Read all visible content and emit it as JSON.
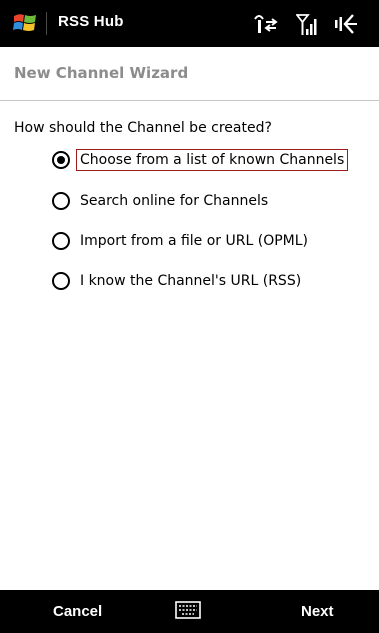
{
  "title_bar": {
    "app_title": "RSS Hub",
    "icons": [
      "windows-start-icon",
      "data-connection-icon",
      "signal-strength-icon",
      "volume-icon"
    ]
  },
  "subheader": {
    "title": "New Channel Wizard"
  },
  "wizard": {
    "question": "How should the Channel be created?",
    "options": [
      {
        "label": "Choose from a list of known Channels",
        "selected": true
      },
      {
        "label": "Search online for Channels",
        "selected": false
      },
      {
        "label": "Import from a file or URL (OPML)",
        "selected": false
      },
      {
        "label": "I know the Channel's URL (RSS)",
        "selected": false
      }
    ]
  },
  "softkeys": {
    "left_label": "Cancel",
    "right_label": "Next",
    "center_icon": "keyboard-icon"
  },
  "colors": {
    "bar_background": "#000000",
    "subheader_text": "#8c8c8c",
    "selection_border": "#9b1c1c"
  }
}
